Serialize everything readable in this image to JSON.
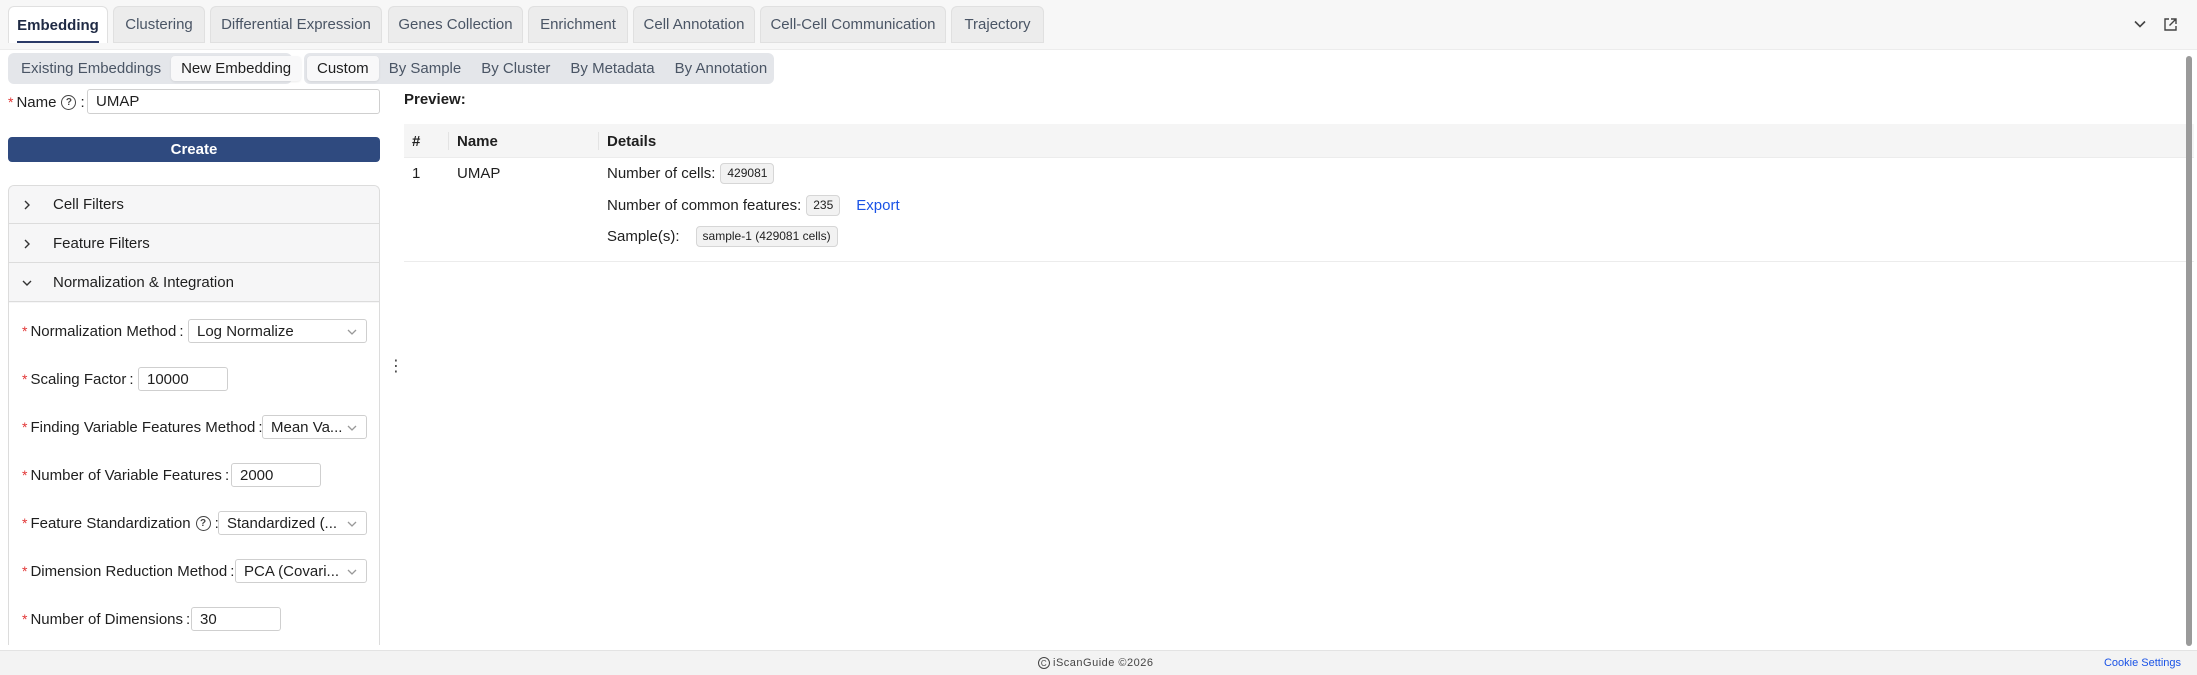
{
  "tabs": [
    {
      "label": "Embedding",
      "active": true
    },
    {
      "label": "Clustering"
    },
    {
      "label": "Differential Expression"
    },
    {
      "label": "Genes Collection"
    },
    {
      "label": "Enrichment"
    },
    {
      "label": "Cell Annotation"
    },
    {
      "label": "Cell-Cell Communication"
    },
    {
      "label": "Trajectory"
    }
  ],
  "toolbar": {
    "mode_options": [
      "Existing Embeddings",
      "New Embedding"
    ],
    "mode_selected": "New Embedding",
    "group_options": [
      "Custom",
      "By Sample",
      "By Cluster",
      "By Metadata",
      "By Annotation"
    ],
    "group_selected": "Custom"
  },
  "form": {
    "name_label": "Name",
    "name_value": "UMAP",
    "create_label": "Create"
  },
  "sections": [
    {
      "label": "Cell Filters",
      "expanded": false
    },
    {
      "label": "Feature Filters",
      "expanded": false
    },
    {
      "label": "Normalization & Integration",
      "expanded": true
    }
  ],
  "fields": {
    "norm_method": {
      "label": "Normalization Method",
      "value": "Log Normalize"
    },
    "scaling_factor": {
      "label": "Scaling Factor",
      "value": "10000"
    },
    "var_method": {
      "label": "Finding Variable Features Method",
      "value": "Mean Va..."
    },
    "num_var": {
      "label": "Number of Variable Features",
      "value": "2000"
    },
    "standardization": {
      "label": "Feature Standardization",
      "value": "Standardized (..."
    },
    "dim_reduction": {
      "label": "Dimension Reduction Method",
      "value": "PCA (Covari..."
    },
    "num_dims": {
      "label": "Number of Dimensions",
      "value": "30"
    }
  },
  "preview": {
    "title": "Preview:",
    "headers": [
      "#",
      "Name",
      "Details"
    ],
    "row": {
      "index": "1",
      "name": "UMAP",
      "cells_label": "Number of cells:",
      "cells_value": "429081",
      "features_label": "Number of common features:",
      "features_value": "235",
      "export_label": "Export",
      "samples_label": "Sample(s):",
      "samples_value": "sample-1 (429081 cells)"
    }
  },
  "footer": {
    "brand": "iScanGuide ©2026",
    "cookie": "Cookie Settings"
  },
  "colors": {
    "primary": "#2f4a7f",
    "link": "#1a53e6",
    "required": "#e23636"
  }
}
